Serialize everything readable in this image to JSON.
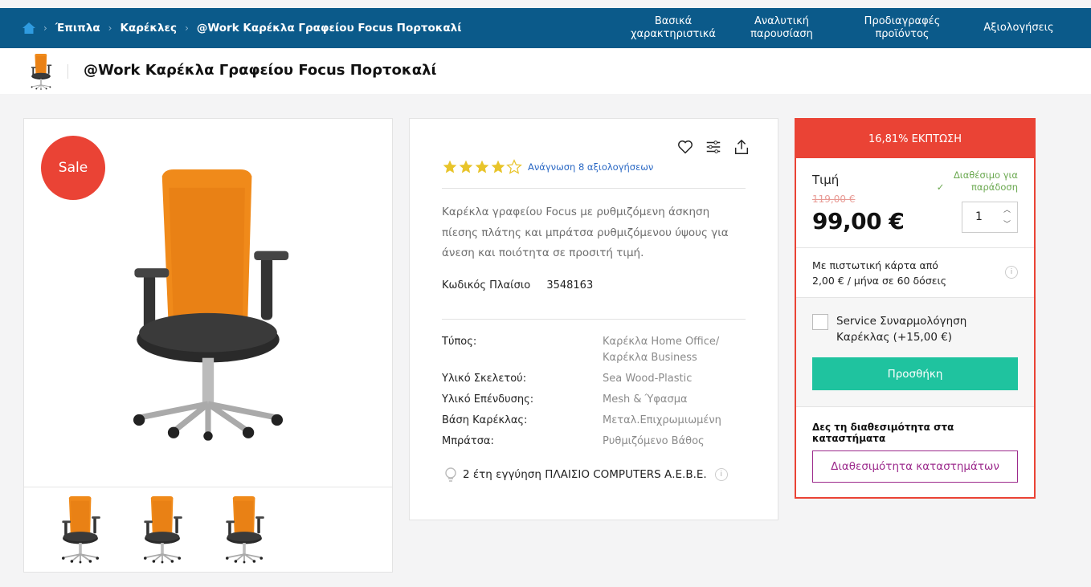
{
  "breadcrumb": {
    "items": [
      "Έπιπλα",
      "Καρέκλες",
      "@Work Καρέκλα Γραφείου Focus Πορτοκαλί"
    ]
  },
  "nav_tabs": [
    {
      "label": "Βασικά χαρακτηριστικά"
    },
    {
      "label": "Αναλυτική παρουσίαση"
    },
    {
      "label": "Προδιαγραφές προϊόντος"
    },
    {
      "label": "Αξιολογήσεις"
    }
  ],
  "product": {
    "title": "@Work Καρέκλα Γραφείου Focus Πορτοκαλί",
    "sale_badge": "Sale",
    "rating": 4,
    "rating_max": 5,
    "reviews_link": "Ανάγνωση 8 αξιολογήσεων",
    "description": "Καρέκλα γραφείου Focus με ρυθμιζόμενη άσκηση πίεσης πλάτης και μπράτσα ρυθμιζόμενου ύψους για άνεση και ποιότητα σε προσιτή τιμή.",
    "code_label": "Κωδικός Πλαίσιο",
    "code_value": "3548163",
    "specs": [
      {
        "key": "Τύπος:",
        "value": "Καρέκλα Home Office/Καρέκλα Business"
      },
      {
        "key": "Υλικό Σκελετού:",
        "value": "Sea Wood-Plastic"
      },
      {
        "key": "Υλικό Επένδυσης:",
        "value": "Mesh & Ύφασμα"
      },
      {
        "key": "Βάση Καρέκλας:",
        "value": "Μεταλ.Επιχρωμιωμένη"
      },
      {
        "key": "Μπράτσα:",
        "value": "Ρυθμιζόμενο Βάθος"
      }
    ],
    "warranty": "2 έτη εγγύηση ΠΛΑΙΣΙΟ COMPUTERS Α.Ε.Β.Ε."
  },
  "buybox": {
    "discount": "16,81% ΕΚΠΤΩΣΗ",
    "price_label": "Τιμή",
    "availability": "Διαθέσιμο για παράδοση",
    "old_price": "119,00 €",
    "new_price": "99,00 €",
    "quantity": "1",
    "credit_line1": "Με πιστωτική κάρτα από",
    "credit_line2": "2,00 € / μήνα σε 60 δόσεις",
    "service_label": "Service Συναρμολόγηση Καρέκλας (+15,00 €)",
    "add_button": "Προσθήκη",
    "stores_label": "Δες τη διαθεσιμότητα στα καταστήματα",
    "stores_button": "Διαθεσιμότητα καταστημάτων"
  },
  "icons": {
    "home": "home-icon",
    "wishlist": "heart-icon",
    "compare": "compare-icon",
    "share": "share-icon",
    "warranty": "bulb-icon",
    "info": "info-icon",
    "check": "check-icon"
  },
  "colors": {
    "topbar": "#0b5a8a",
    "sale": "#ea4335",
    "add_button": "#1fc39f",
    "stores_button": "#9c2a8c",
    "available": "#6aa84f",
    "star": "#e8c42a"
  }
}
